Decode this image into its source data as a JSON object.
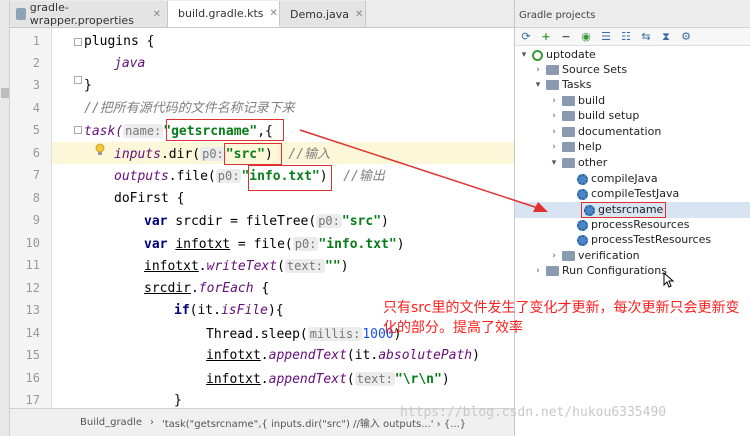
{
  "tabs": [
    {
      "label": "gradle-wrapper.properties",
      "icon": "properties-file-icon",
      "color": "#8fa3b8"
    },
    {
      "label": "build.gradle.kts",
      "icon": "gradle-file-icon",
      "color": "#4a86c8"
    },
    {
      "label": "Demo.java",
      "icon": "java-class-icon",
      "color": "#3a9ad9"
    }
  ],
  "editor": {
    "line_numbers": [
      "1",
      "2",
      "3",
      "4",
      "5",
      "6",
      "7",
      "8",
      "9",
      "10",
      "11",
      "12",
      "13",
      "14",
      "15",
      "16",
      "17"
    ],
    "lines": {
      "l1": "plugins {",
      "l2": "java",
      "l3": "}",
      "l4": "//把所有源代码的文件名称记录下来",
      "l5_a": "task(",
      "l5_hint": "name:",
      "l5_str": "\"getsrcname\"",
      "l5_b": ",{",
      "l6_a": "inputs",
      "l6_b": ".dir(",
      "l6_hint": "p0:",
      "l6_str": "\"src\"",
      "l6_c": ")",
      "l6_cmt": "//输入",
      "l7_a": "outputs",
      "l7_b": ".file(",
      "l7_hint": "p0:",
      "l7_str": "\"info.txt\"",
      "l7_c": ")",
      "l7_cmt": "//输出",
      "l8": "doFirst {",
      "l9_kw": "var",
      "l9_a": " srcdir = fileTree(",
      "l9_hint": "p0:",
      "l9_str": "\"src\"",
      "l9_b": ")",
      "l10_kw": "var",
      "l10_a": "infotxt",
      "l10_b": " = file(",
      "l10_hint": "p0:",
      "l10_str": "\"info.txt\"",
      "l10_c": ")",
      "l11_a": "infotxt",
      "l11_b": ".",
      "l11_m": "writeText",
      "l11_c": "(",
      "l11_hint": "text:",
      "l11_str": "\"\"",
      "l11_d": ")",
      "l12_a": "srcdir",
      "l12_b": ".",
      "l12_m": "forEach",
      "l12_c": " {",
      "l13_kw": "if",
      "l13_a": "(it.",
      "l13_m": "isFile",
      "l13_b": "){",
      "l14_a": "Thread.sleep(",
      "l14_hint": "millis:",
      "l14_num": "1000",
      "l14_b": ")",
      "l15_a": "infotxt",
      "l15_b": ".",
      "l15_m": "appendText",
      "l15_c": "(it.",
      "l15_p": "absolutePath",
      "l15_d": ")",
      "l16_a": "infotxt",
      "l16_b": ".",
      "l16_m": "appendText",
      "l16_c": "(",
      "l16_hint": "text:",
      "l16_str": "\"\\r\\n\"",
      "l16_d": ")",
      "l17": "}"
    }
  },
  "statusbar": {
    "crumb1": "Build_gradle",
    "sep": "›",
    "crumb2": "'task(\"getsrcname\",{ inputs.dir(\"src\") //输入 outputs...' › {...}"
  },
  "gradle_panel": {
    "title": "Gradle projects",
    "toolbar_icons": [
      "refresh-icon",
      "add-icon",
      "remove-icon",
      "run-icon",
      "expand-all-icon",
      "collapse-all-icon",
      "link-icon",
      "toggle-offline-icon",
      "settings-icon"
    ],
    "tree": [
      {
        "label": "uptodate",
        "level": 0,
        "arrow": "▾",
        "icon": "gradle-project-icon"
      },
      {
        "label": "Source Sets",
        "level": 1,
        "arrow": "›",
        "icon": "folder-icon"
      },
      {
        "label": "Tasks",
        "level": 1,
        "arrow": "▾",
        "icon": "folder-icon"
      },
      {
        "label": "build",
        "level": 2,
        "arrow": "›",
        "icon": "folder-icon"
      },
      {
        "label": "build setup",
        "level": 2,
        "arrow": "›",
        "icon": "folder-icon"
      },
      {
        "label": "documentation",
        "level": 2,
        "arrow": "›",
        "icon": "folder-icon"
      },
      {
        "label": "help",
        "level": 2,
        "arrow": "›",
        "icon": "folder-icon"
      },
      {
        "label": "other",
        "level": 2,
        "arrow": "▾",
        "icon": "folder-icon"
      },
      {
        "label": "compileJava",
        "level": 3,
        "arrow": "",
        "icon": "gear-icon"
      },
      {
        "label": "compileTestJava",
        "level": 3,
        "arrow": "",
        "icon": "gear-icon"
      },
      {
        "label": "getsrcname",
        "level": 3,
        "arrow": "",
        "icon": "gear-icon",
        "selected": true
      },
      {
        "label": "processResources",
        "level": 3,
        "arrow": "",
        "icon": "gear-icon"
      },
      {
        "label": "processTestResources",
        "level": 3,
        "arrow": "",
        "icon": "gear-icon"
      },
      {
        "label": "verification",
        "level": 2,
        "arrow": "›",
        "icon": "folder-icon"
      },
      {
        "label": "Run Configurations",
        "level": 1,
        "arrow": "›",
        "icon": "folder-icon"
      }
    ]
  },
  "annotation": "只有src里的文件发生了变化才更新，每次更新只会更新变化的部分。提高了效率",
  "watermark": "https://blog.csdn.net/hukou6335490",
  "colors": {
    "annotation_red": "#ff2020",
    "box_red": "#e03030",
    "selection": "#d9e4f2"
  }
}
